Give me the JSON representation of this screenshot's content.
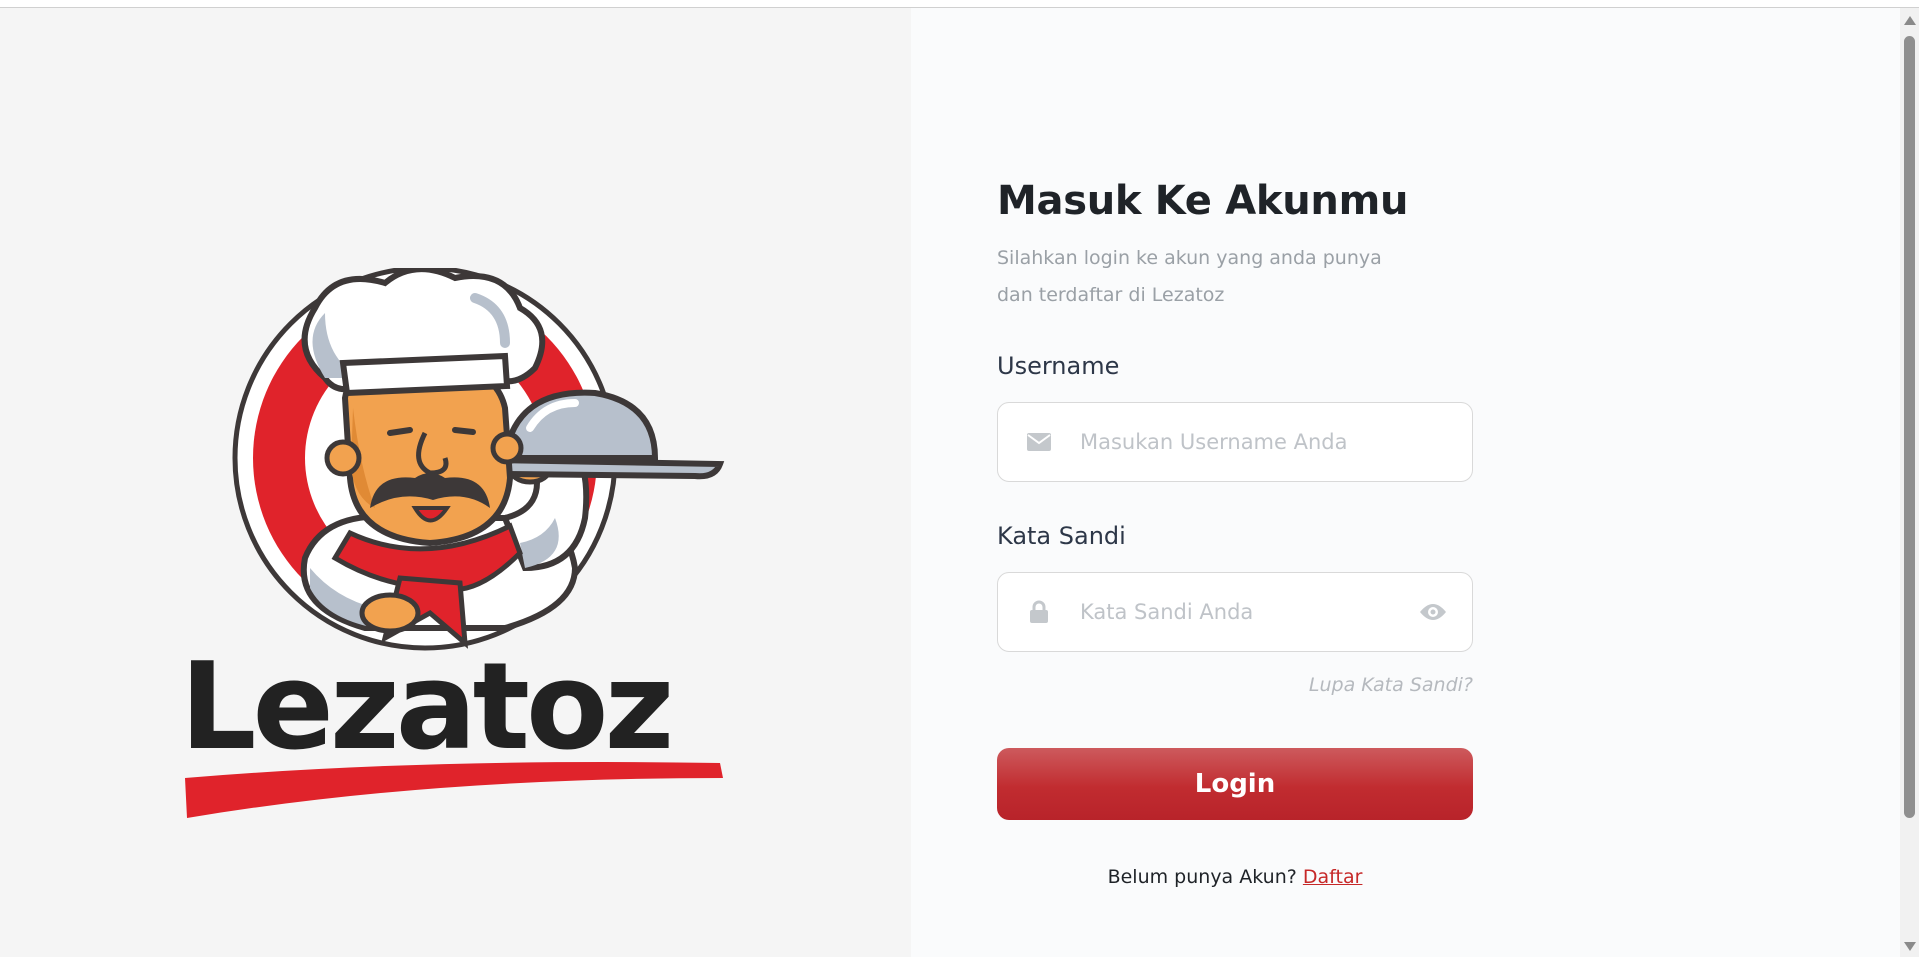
{
  "brand": {
    "name": "Lezatoz",
    "colors": {
      "red": "#e0232b",
      "dark": "#3d3838",
      "skin": "#f2a24f",
      "hat_shade": "#b7c0cc"
    }
  },
  "form": {
    "title": "Masuk Ke Akunmu",
    "subtitle": "Silahkan login ke akun yang anda punya dan terdaftar di Lezatoz",
    "username": {
      "label": "Username",
      "placeholder": "Masukan Username Anda",
      "value": "",
      "icon": "mail-icon"
    },
    "password": {
      "label": "Kata Sandi",
      "placeholder": "Kata Sandi Anda",
      "value": "",
      "icon": "lock-icon",
      "toggle_icon": "eye-icon"
    },
    "forgot_label": "Lupa Kata Sandi?",
    "login_label": "Login",
    "register_prompt": "Belum punya Akun?",
    "register_label": "Daftar"
  },
  "theme": {
    "accent": "#c12c30",
    "link": "#c62828"
  }
}
